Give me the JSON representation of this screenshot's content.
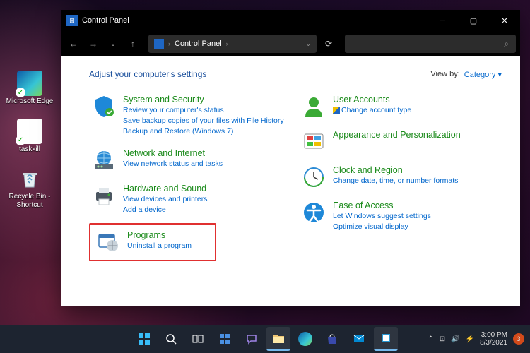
{
  "desktop": {
    "icons": [
      {
        "label": "Microsoft Edge"
      },
      {
        "label": "taskkill"
      },
      {
        "label": "Recycle Bin - Shortcut"
      }
    ]
  },
  "window": {
    "title": "Control Panel",
    "breadcrumb": [
      "Control Panel"
    ],
    "search_placeholder": "",
    "heading": "Adjust your computer's settings",
    "viewby_label": "View by:",
    "viewby_value": "Category",
    "categories_left": [
      {
        "title": "System and Security",
        "links": [
          "Review your computer's status",
          "Save backup copies of your files with File History",
          "Backup and Restore (Windows 7)"
        ]
      },
      {
        "title": "Network and Internet",
        "links": [
          "View network status and tasks"
        ]
      },
      {
        "title": "Hardware and Sound",
        "links": [
          "View devices and printers",
          "Add a device"
        ]
      },
      {
        "title": "Programs",
        "links": [
          "Uninstall a program"
        ]
      }
    ],
    "categories_right": [
      {
        "title": "User Accounts",
        "links": [
          "Change account type"
        ],
        "shield": true
      },
      {
        "title": "Appearance and Personalization",
        "links": []
      },
      {
        "title": "Clock and Region",
        "links": [
          "Change date, time, or number formats"
        ]
      },
      {
        "title": "Ease of Access",
        "links": [
          "Let Windows suggest settings",
          "Optimize visual display"
        ]
      }
    ]
  },
  "taskbar": {
    "time": "3:00 PM",
    "date": "8/3/2021",
    "notifications": "3"
  }
}
